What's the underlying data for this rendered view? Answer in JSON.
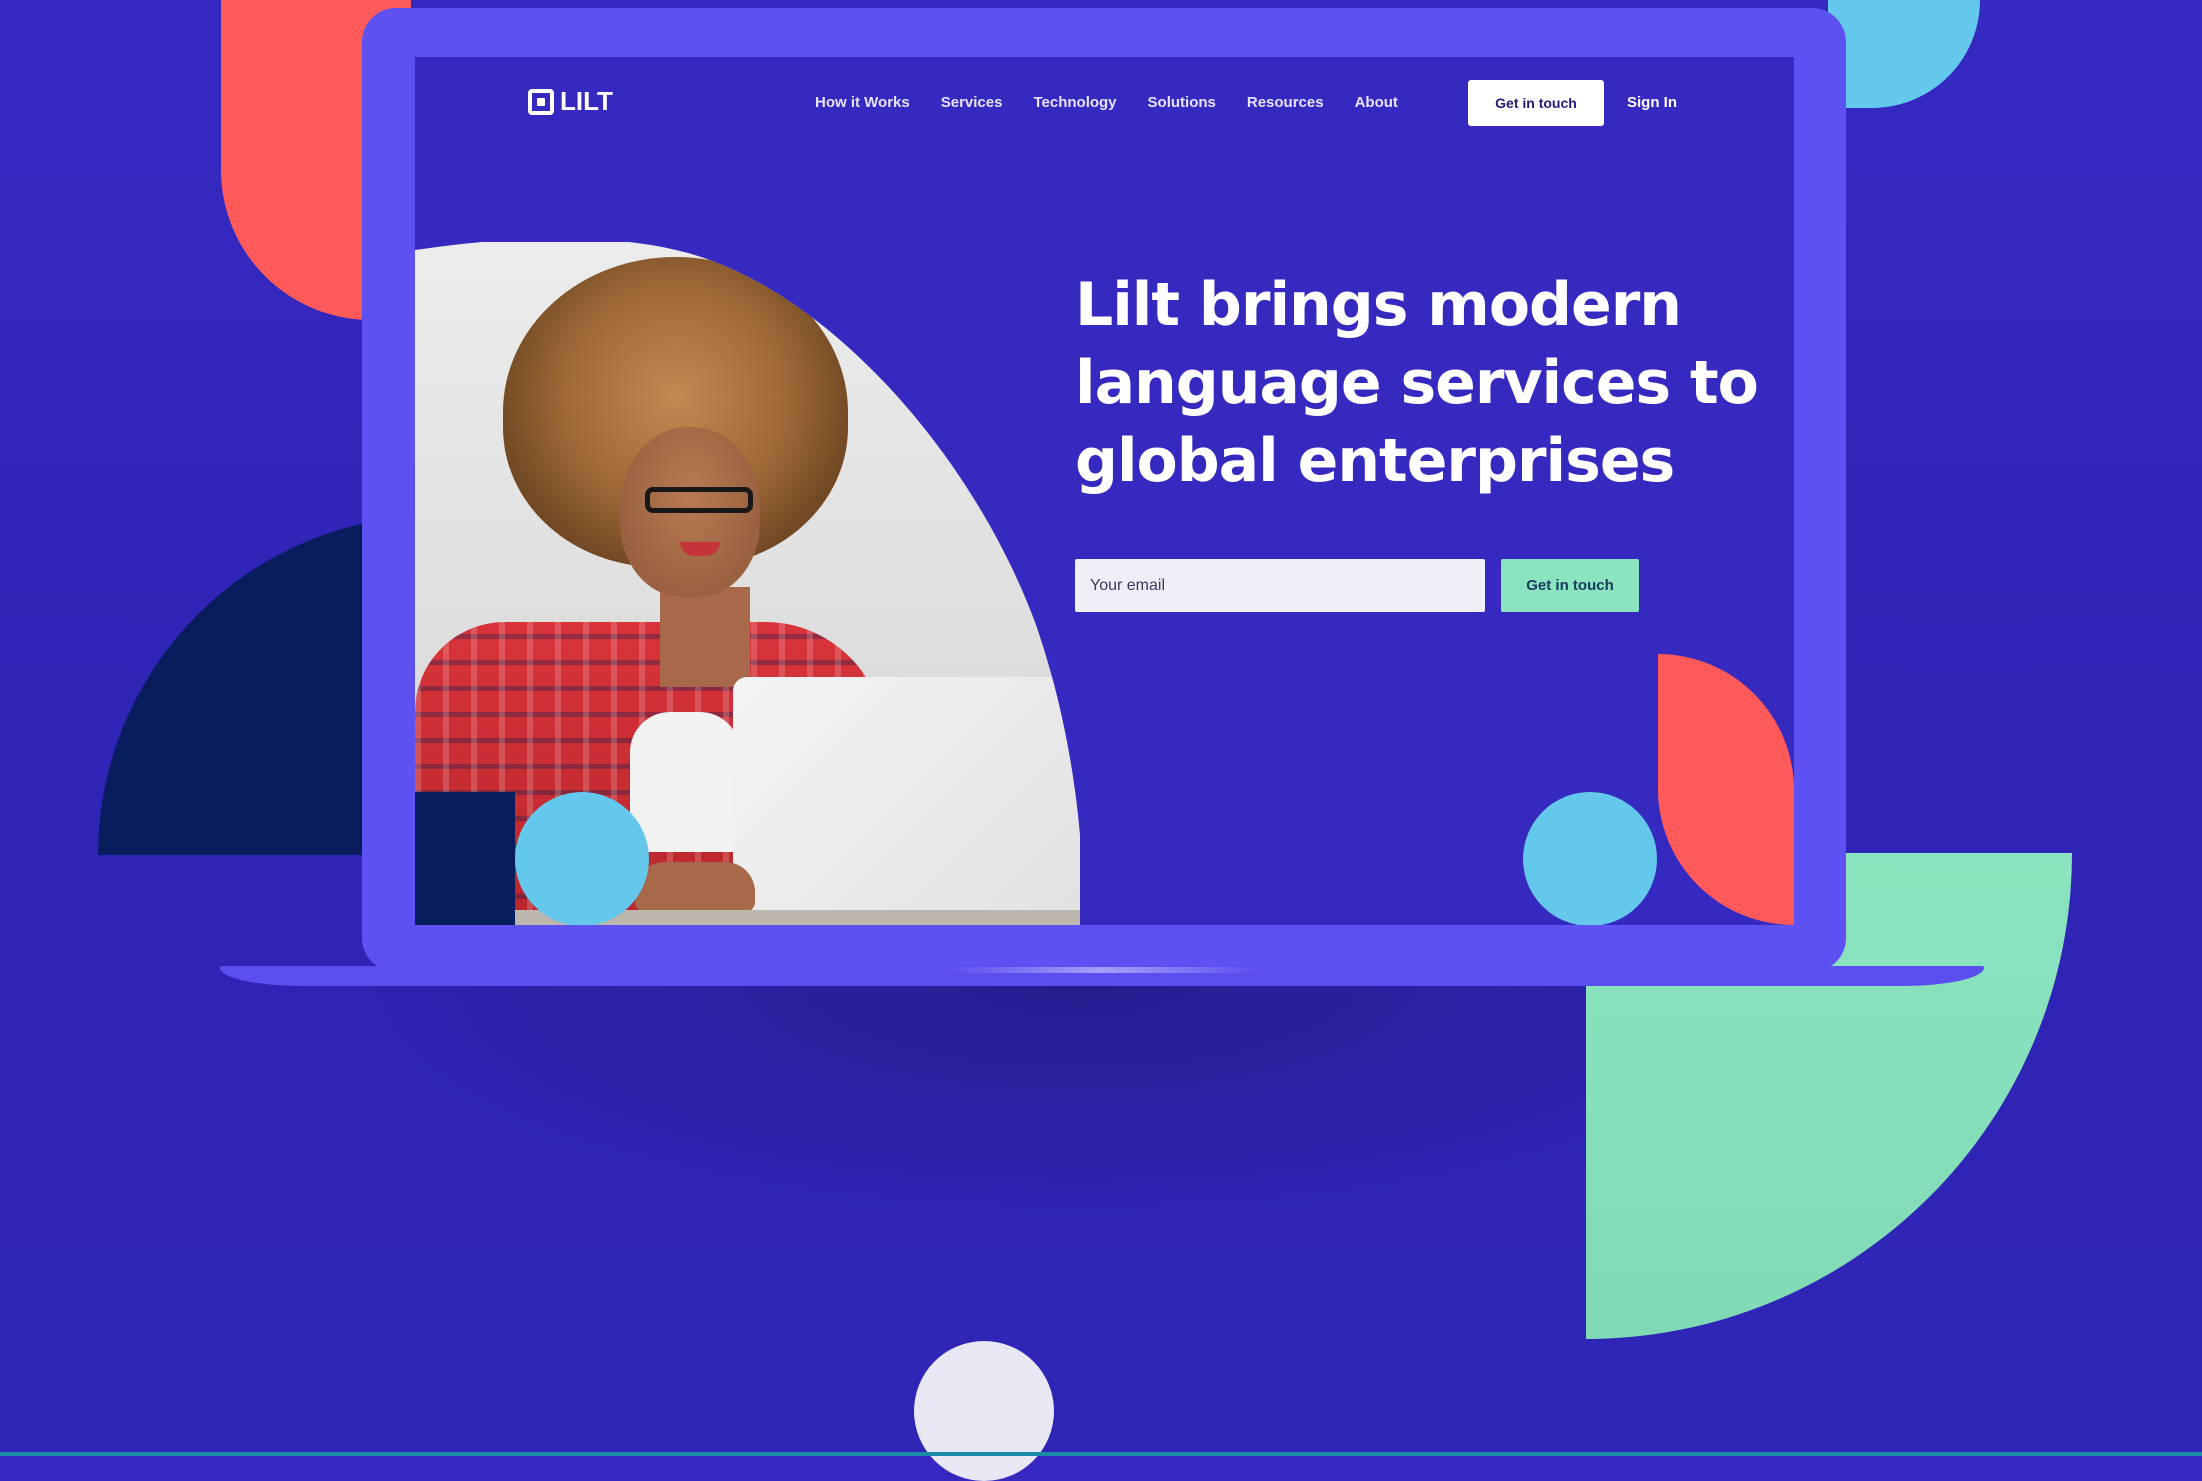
{
  "brand": {
    "name": "LILT",
    "colors": {
      "page_background": "#3428c0",
      "screen_background": "#3629c0",
      "laptop": "#5e51f2",
      "accent_red": "#ff5a5a",
      "accent_blue": "#63c8ec",
      "accent_green": "#8ae4bf",
      "accent_navy": "#081d5e"
    }
  },
  "nav": {
    "items": [
      {
        "label": "How it Works"
      },
      {
        "label": "Services"
      },
      {
        "label": "Technology"
      },
      {
        "label": "Solutions"
      },
      {
        "label": "Resources"
      },
      {
        "label": "About"
      }
    ],
    "cta_label": "Get in touch",
    "signin_label": "Sign In"
  },
  "hero": {
    "title": "Lilt brings modern language services to global enterprises",
    "email_placeholder": "Your email",
    "cta_label": "Get in touch"
  }
}
